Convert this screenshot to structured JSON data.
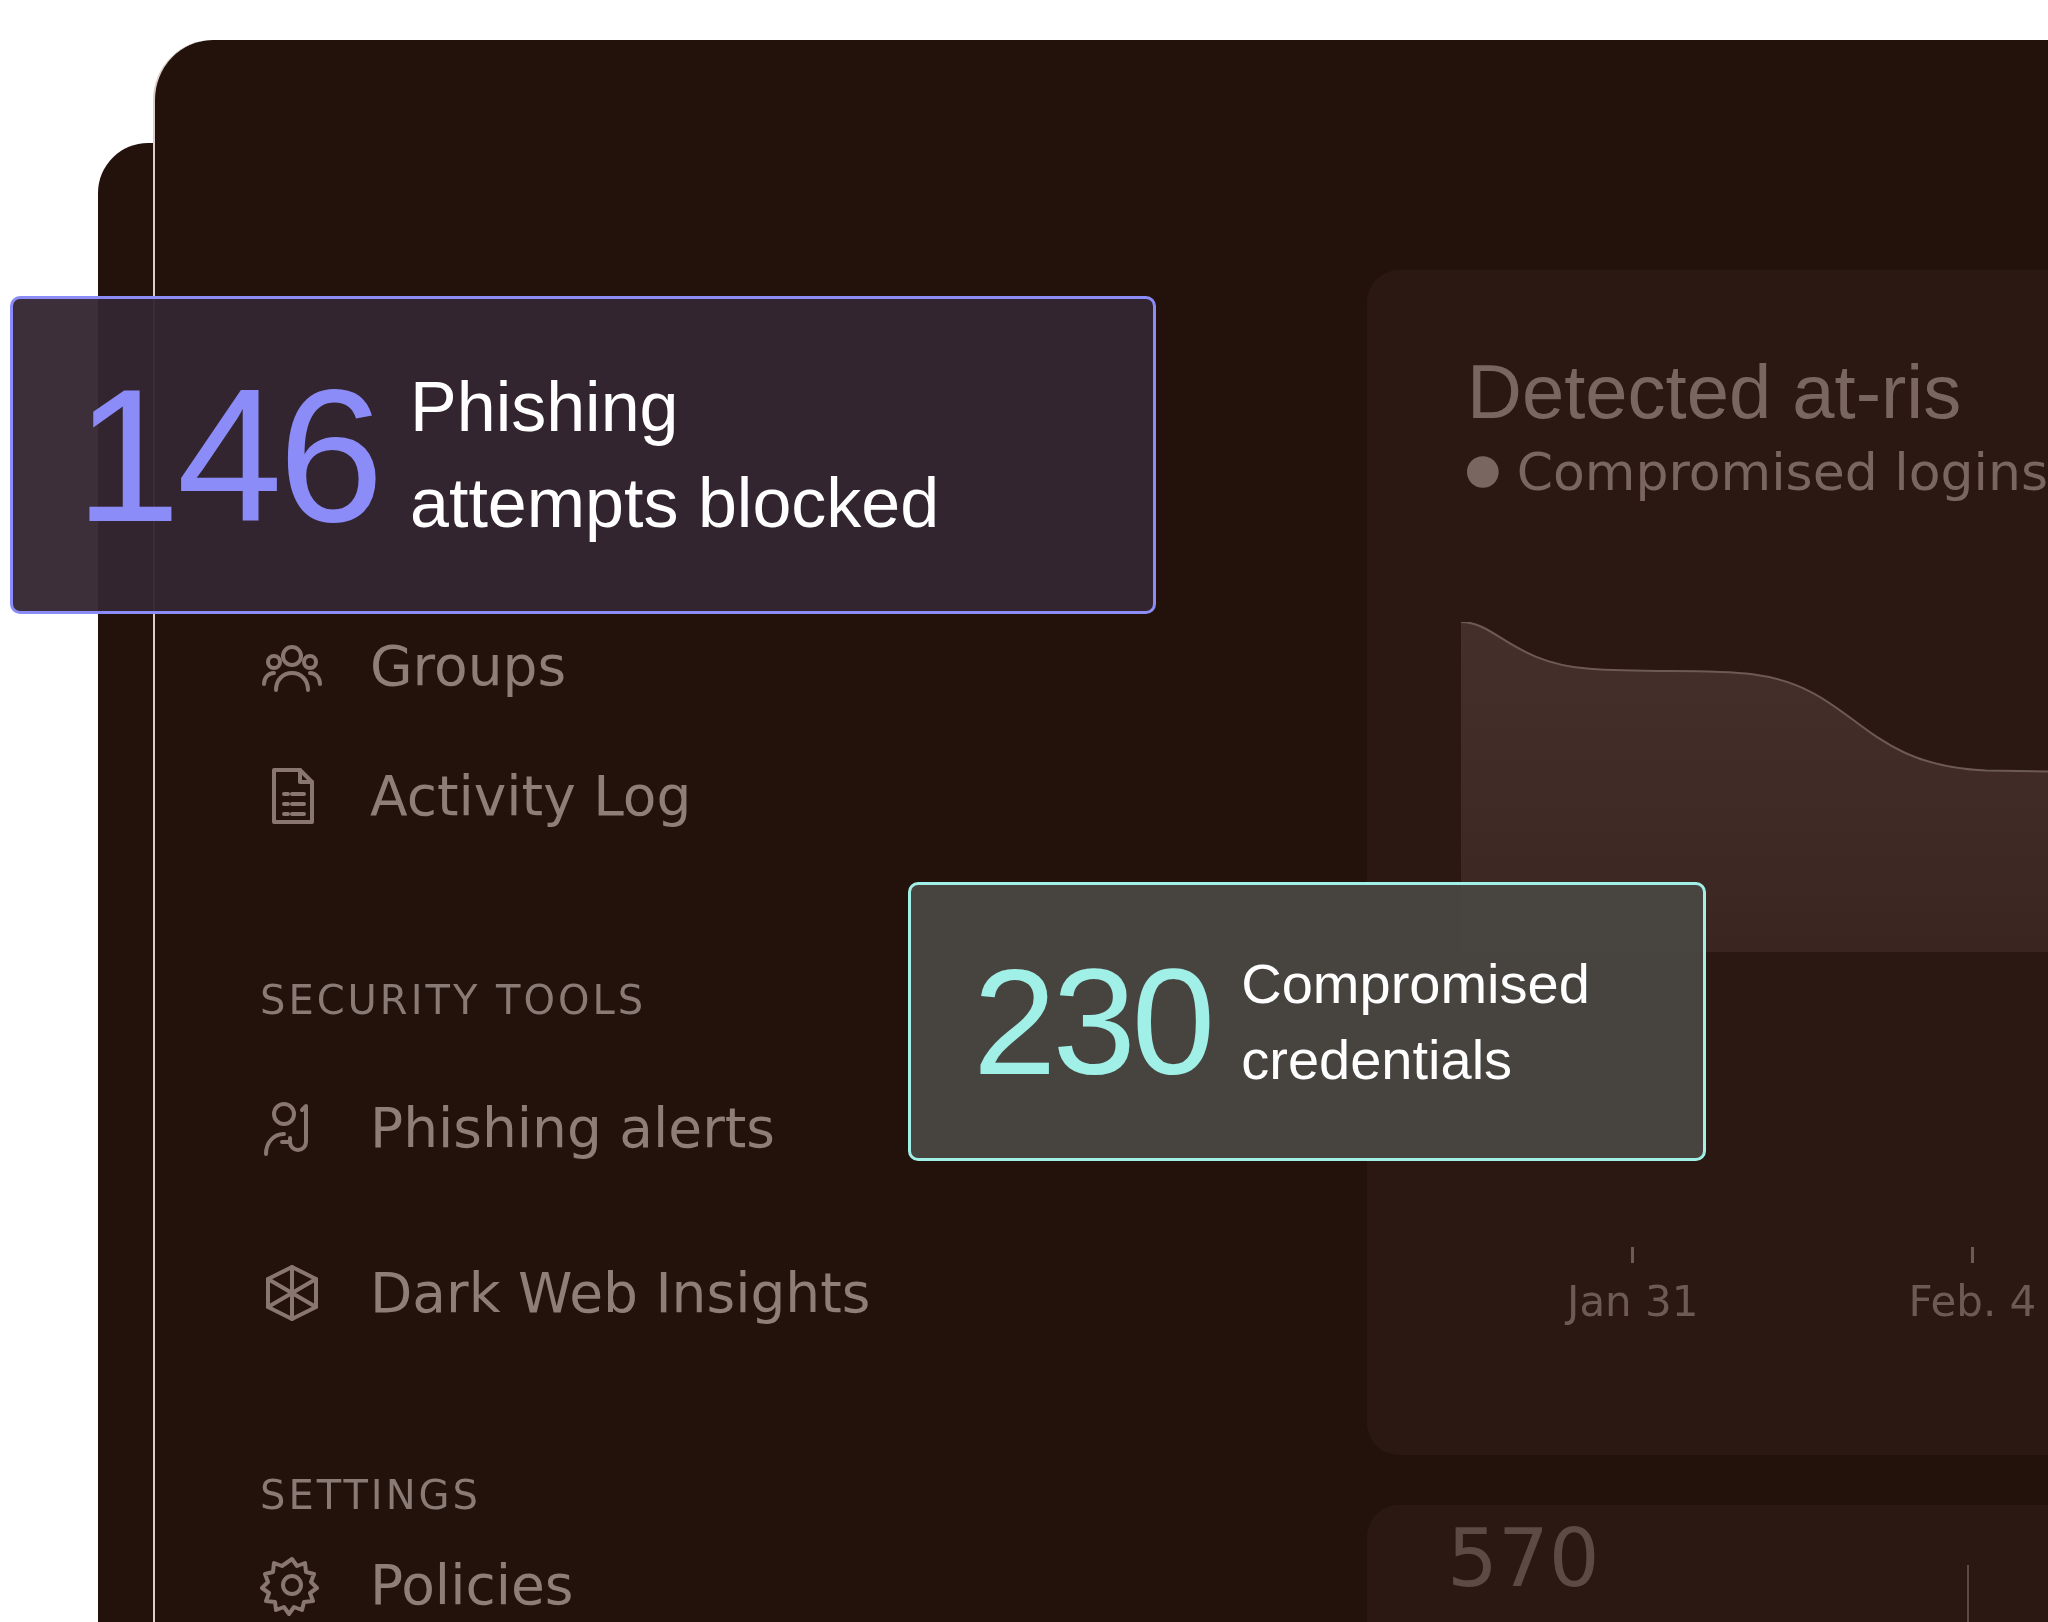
{
  "sidebar": {
    "sections": [
      {
        "items": [
          {
            "label": "Groups"
          },
          {
            "label": "Activity Log"
          }
        ]
      },
      {
        "heading": "SECURITY TOOLS",
        "items": [
          {
            "label": "Phishing alerts"
          },
          {
            "label": "Dark Web Insights"
          }
        ]
      },
      {
        "heading": "SETTINGS",
        "items": [
          {
            "label": "Policies"
          }
        ]
      }
    ]
  },
  "chart_card": {
    "title": "Detected at-ris",
    "legend": "Compromised logins",
    "x_labels": [
      "Jan 31",
      "Feb. 4"
    ]
  },
  "bottom_card": {
    "value": "570"
  },
  "stats": [
    {
      "value": "146",
      "label": "Phishing",
      "label_2": "attempts blocked",
      "color": "#8b8cf7"
    },
    {
      "value": "230",
      "label": "Compromised",
      "label_2": "credentials",
      "color": "#a0f0e8"
    }
  ]
}
